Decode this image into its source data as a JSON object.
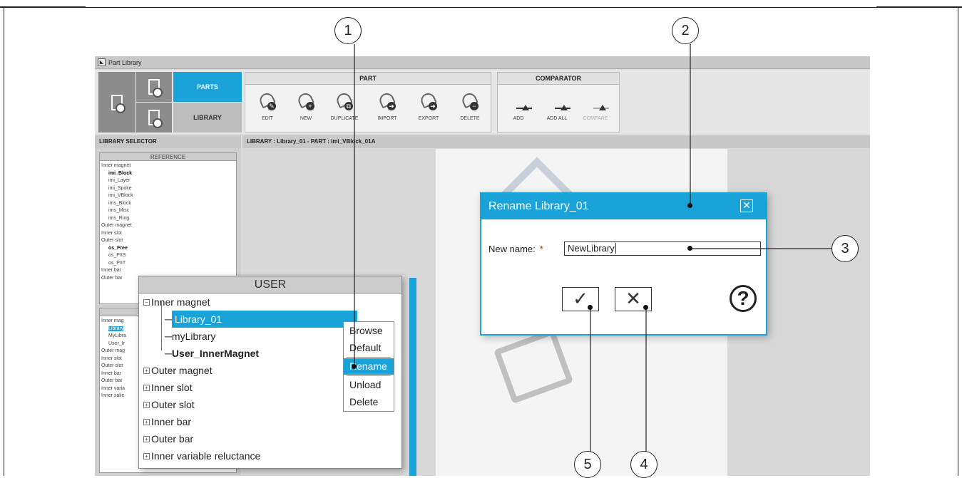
{
  "app_title": "Part Library",
  "ribbon": {
    "tab_parts": "PARTS",
    "tab_library": "LIBRARY",
    "part_group": "PART",
    "comparator_group": "COMPARATOR",
    "part_tools": [
      {
        "label": "EDIT",
        "badge": "✎"
      },
      {
        "label": "NEW",
        "badge": "+"
      },
      {
        "label": "DUPLICATE",
        "badge": "⧉"
      },
      {
        "label": "IMPORT",
        "badge": "➜"
      },
      {
        "label": "EXPORT",
        "badge": "➜"
      },
      {
        "label": "DELETE",
        "badge": "−"
      }
    ],
    "comparator_tools": [
      {
        "label": "ADD"
      },
      {
        "label": "ADD ALL"
      },
      {
        "label": "COMPARE"
      }
    ]
  },
  "sidebar": {
    "title": "LIBRARY SELECTOR",
    "reference_header": "REFERENCE",
    "reference_tree": [
      {
        "text": "Inner magnet",
        "level": 0
      },
      {
        "text": "imi_Block",
        "level": 1,
        "bold": true
      },
      {
        "text": "imi_Layer",
        "level": 1
      },
      {
        "text": "imi_Spoke",
        "level": 1
      },
      {
        "text": "imi_VBlock",
        "level": 1
      },
      {
        "text": "ims_Block",
        "level": 1
      },
      {
        "text": "ims_Misc",
        "level": 1
      },
      {
        "text": "ims_Ring",
        "level": 1
      },
      {
        "text": "Outer magnet",
        "level": 0
      },
      {
        "text": "Inner slot",
        "level": 0
      },
      {
        "text": "Outer slot",
        "level": 0
      },
      {
        "text": "os_Free",
        "level": 1,
        "bold": true
      },
      {
        "text": "os_PIIS",
        "level": 1
      },
      {
        "text": "os_PIIT",
        "level": 1
      },
      {
        "text": "Inner bar",
        "level": 0
      },
      {
        "text": "Outer bar",
        "level": 0
      }
    ],
    "user_tree_small": [
      {
        "text": "Inner mag",
        "level": 0
      },
      {
        "text": "Library",
        "level": 1,
        "sel": true
      },
      {
        "text": "MyLibra",
        "level": 1
      },
      {
        "text": "User_Ir",
        "level": 1
      },
      {
        "text": "Outer mag",
        "level": 0
      },
      {
        "text": "Inner slot",
        "level": 0
      },
      {
        "text": "Outer slot",
        "level": 0
      },
      {
        "text": "Inner bar",
        "level": 0
      },
      {
        "text": "Outer bar",
        "level": 0
      },
      {
        "text": "Inner varia",
        "level": 0
      },
      {
        "text": "Inner salie",
        "level": 0
      }
    ]
  },
  "main_header": "LIBRARY : Library_01  -  PART : imi_VBlock_01A",
  "user_popup": {
    "header": "USER",
    "tree": [
      {
        "text": "Inner magnet",
        "level": 0,
        "expander": "−"
      },
      {
        "text": "Library_01",
        "level": 1,
        "sel": true
      },
      {
        "text": "myLibrary",
        "level": 1
      },
      {
        "text": "User_InnerMagnet",
        "level": 1,
        "bold": true
      },
      {
        "text": "Outer magnet",
        "level": 0,
        "expander": "+"
      },
      {
        "text": "Inner slot",
        "level": 0,
        "expander": "+"
      },
      {
        "text": "Outer slot",
        "level": 0,
        "expander": "+"
      },
      {
        "text": "Inner bar",
        "level": 0,
        "expander": "+"
      },
      {
        "text": "Outer bar",
        "level": 0,
        "expander": "+"
      },
      {
        "text": "Inner variable reluctance",
        "level": 0,
        "expander": "+"
      }
    ]
  },
  "context_menu": {
    "items": [
      "Browse",
      "Default",
      "Rename",
      "Unload",
      "Delete"
    ],
    "active": "Rename"
  },
  "dialog": {
    "title": "Rename Library_01",
    "close_glyph": "✕",
    "field_label": "New name:",
    "required_mark": "*",
    "field_value": "NewLibrary",
    "ok_glyph": "✓",
    "cancel_glyph": "✕",
    "help_glyph": "?"
  },
  "callouts": [
    "1",
    "2",
    "3",
    "4",
    "5"
  ],
  "colors": {
    "accent": "#1aa3d8",
    "required": "#d02020"
  }
}
